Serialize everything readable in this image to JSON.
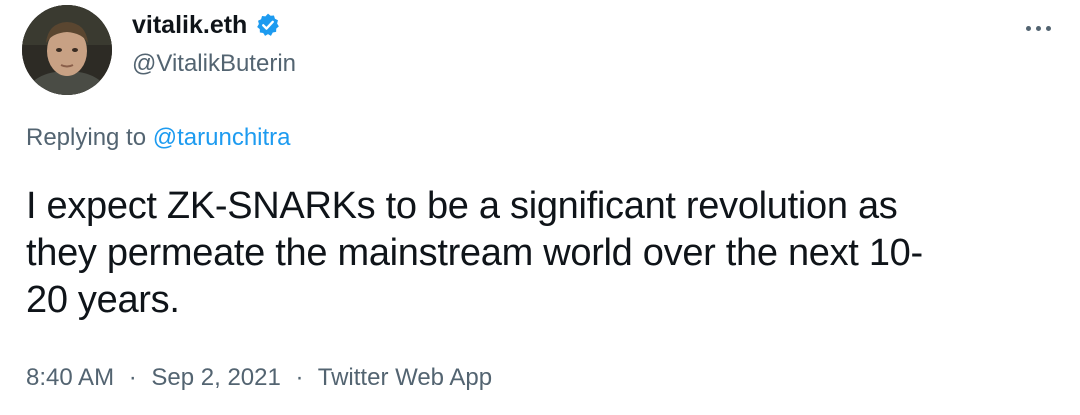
{
  "author": {
    "display_name": "vitalik.eth",
    "handle": "@VitalikButerin",
    "verified": true,
    "avatar_icon": "profile-photo"
  },
  "reply": {
    "prefix": "Replying to",
    "mention": "@tarunchitra"
  },
  "tweet": {
    "lines": [
      "I expect ZK-SNARKs to be a significant revolution as",
      "they permeate the mainstream world over the next 10-",
      "20 years."
    ]
  },
  "meta": {
    "time": "8:40 AM",
    "separator": "·",
    "date": "Sep 2, 2021",
    "source": "Twitter Web App"
  },
  "colors": {
    "text": "#0f1419",
    "secondary": "#536471",
    "link": "#1d9bf0",
    "verified": "#1d9bf0"
  }
}
